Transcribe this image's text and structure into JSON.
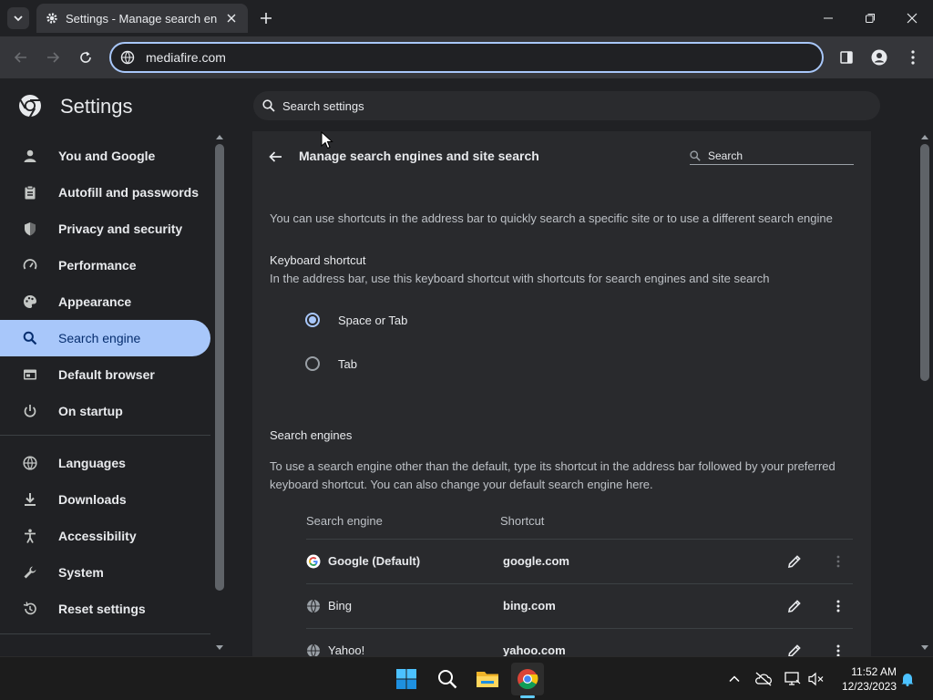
{
  "browser": {
    "tab_title": "Settings - Manage search engines and site search",
    "address": "mediafire.com"
  },
  "settings": {
    "title": "Settings",
    "search_placeholder": "Search settings"
  },
  "sidebar": {
    "items": [
      {
        "label": "You and Google",
        "icon": "person-icon"
      },
      {
        "label": "Autofill and passwords",
        "icon": "clipboard-icon"
      },
      {
        "label": "Privacy and security",
        "icon": "shield-icon"
      },
      {
        "label": "Performance",
        "icon": "speedometer-icon"
      },
      {
        "label": "Appearance",
        "icon": "palette-icon"
      },
      {
        "label": "Search engine",
        "icon": "search-icon",
        "active": true
      },
      {
        "label": "Default browser",
        "icon": "browser-icon"
      },
      {
        "label": "On startup",
        "icon": "power-icon"
      },
      {
        "label": "Languages",
        "icon": "globe-icon"
      },
      {
        "label": "Downloads",
        "icon": "download-icon"
      },
      {
        "label": "Accessibility",
        "icon": "accessibility-icon"
      },
      {
        "label": "System",
        "icon": "wrench-icon"
      },
      {
        "label": "Reset settings",
        "icon": "history-icon"
      }
    ]
  },
  "page": {
    "title": "Manage search engines and site search",
    "search_label": "Search",
    "intro": "You can use shortcuts in the address bar to quickly search a specific site or to use a different search engine",
    "keyboard_shortcut": {
      "title": "Keyboard shortcut",
      "description": "In the address bar, use this keyboard shortcut with shortcuts for search engines and site search",
      "options": [
        {
          "label": "Space or Tab",
          "checked": true
        },
        {
          "label": "Tab",
          "checked": false
        }
      ]
    },
    "search_engines": {
      "title": "Search engines",
      "description": "To use a search engine other than the default, type its shortcut in the address bar followed by your preferred keyboard shortcut. You can also change your default search engine here.",
      "columns": [
        "Search engine",
        "Shortcut"
      ],
      "rows": [
        {
          "name": "Google (Default)",
          "shortcut": "google.com",
          "icon": "google-icon"
        },
        {
          "name": "Bing",
          "shortcut": "bing.com",
          "icon": "globe-icon"
        },
        {
          "name": "Yahoo!",
          "shortcut": "yahoo.com",
          "icon": "globe-icon"
        }
      ]
    }
  },
  "taskbar": {
    "apps": [
      "windows-start-icon",
      "search-icon",
      "file-explorer-icon",
      "chrome-icon"
    ],
    "time": "11:52 AM",
    "date": "12/23/2023"
  },
  "colors": {
    "accent": "#a8c7fa",
    "background": "#202124",
    "card": "#292a2d"
  }
}
